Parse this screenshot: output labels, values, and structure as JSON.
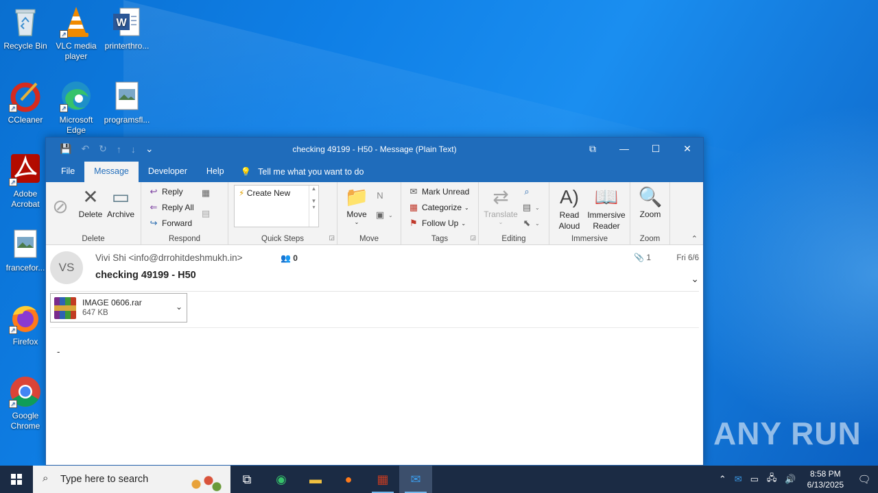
{
  "desktop": {
    "icons": [
      {
        "label": "Recycle Bin"
      },
      {
        "label": "VLC media player"
      },
      {
        "label": "printerthro..."
      },
      {
        "label": "CCleaner"
      },
      {
        "label": "Microsoft Edge"
      },
      {
        "label": "programsfl..."
      },
      {
        "label": "Adobe Acrobat"
      },
      {
        "label": "francefor..."
      },
      {
        "label": "Firefox"
      },
      {
        "label": "Google Chrome"
      }
    ],
    "watermark": "ANY RUN"
  },
  "window": {
    "title": "checking 49199 - H50  -  Message (Plain Text)",
    "tabs": [
      "File",
      "Message",
      "Developer",
      "Help"
    ],
    "active_tab": "Message",
    "tell_me": "Tell me what you want to do"
  },
  "ribbon": {
    "delete_group": {
      "label": "Delete",
      "delete": "Delete",
      "archive": "Archive"
    },
    "respond_group": {
      "label": "Respond",
      "reply": "Reply",
      "reply_all": "Reply All",
      "forward": "Forward"
    },
    "quick_steps": {
      "label": "Quick Steps",
      "create_new": "Create New"
    },
    "move_group": {
      "label": "Move",
      "move": "Move"
    },
    "tags_group": {
      "label": "Tags",
      "mark_unread": "Mark Unread",
      "categorize": "Categorize",
      "follow_up": "Follow Up"
    },
    "editing_group": {
      "label": "Editing",
      "translate": "Translate"
    },
    "immersive_group": {
      "label": "Immersive",
      "read_aloud": "Read Aloud",
      "immersive_reader": "Immersive Reader"
    },
    "zoom_group": {
      "label": "Zoom",
      "zoom": "Zoom"
    }
  },
  "message": {
    "avatar_initials": "VS",
    "from": "Vivi Shi <info@drrohitdeshmukh.in>",
    "people_count": "0",
    "subject": "checking 49199 - H50",
    "attachment_count": "1",
    "date": "Fri 6/6",
    "attachment": {
      "name": "IMAGE 0606.rar",
      "size": "647 KB"
    },
    "body": "-"
  },
  "taskbar": {
    "search_placeholder": "Type here to search",
    "time": "8:58 PM",
    "date": "6/13/2025"
  }
}
